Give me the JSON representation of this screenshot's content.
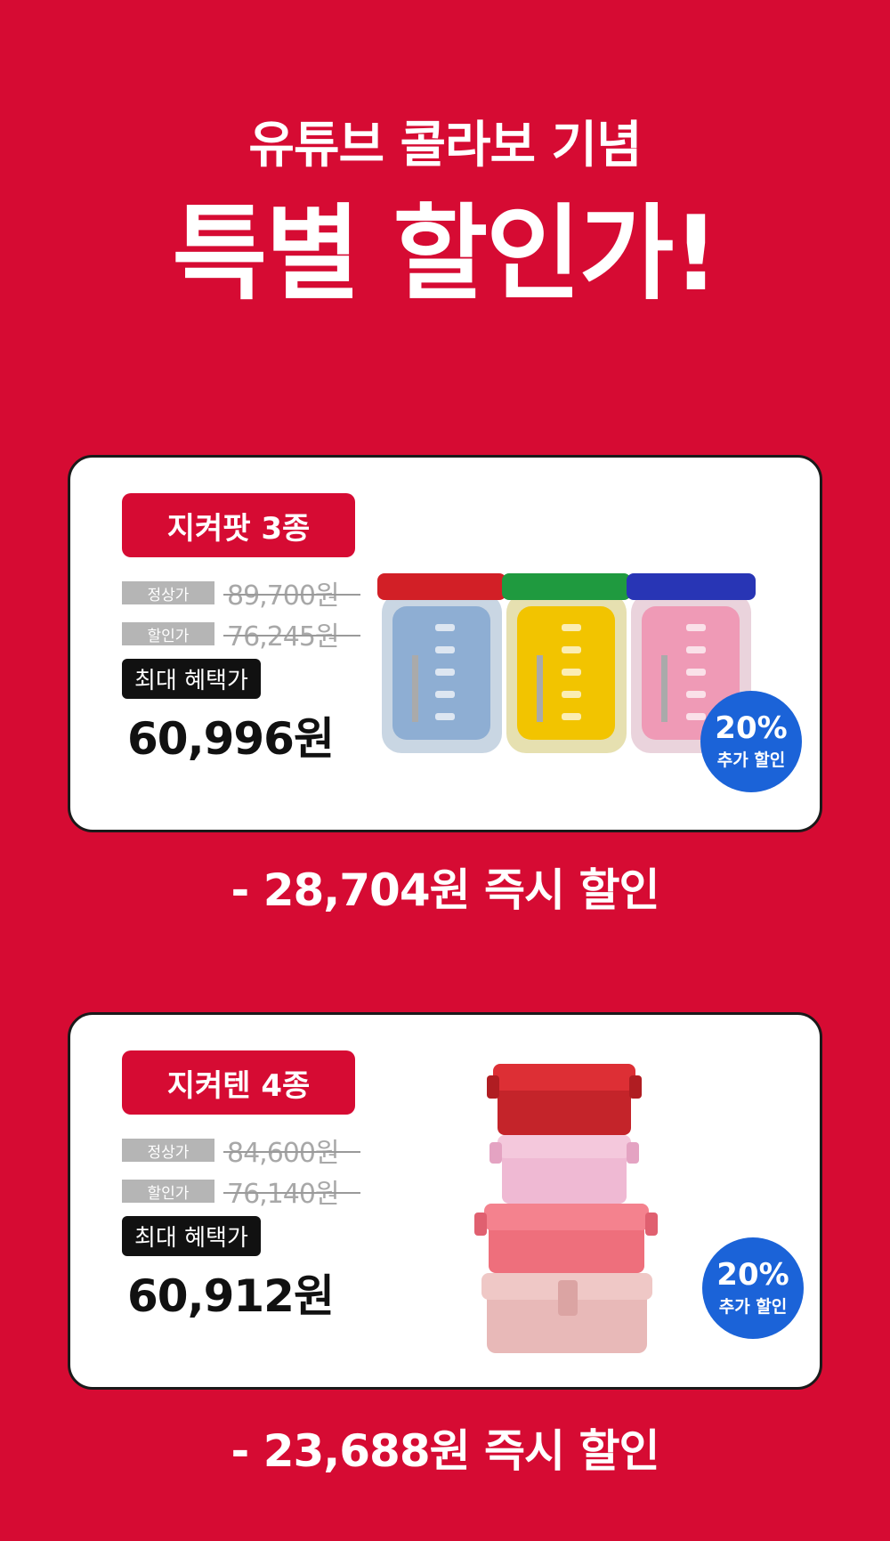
{
  "headline": {
    "line1": "유튜브 콜라보 기념",
    "line2": "특별 할인가!"
  },
  "products": [
    {
      "name": "지켜팟 3종",
      "regular_label": "정상가",
      "regular_price": "89,700원",
      "sale_label": "할인가",
      "sale_price": "76,245원",
      "benefit_label": "최대 혜택가",
      "final_price": "60,996원",
      "badge_pct": "20%",
      "badge_text": "추가 할인",
      "discount_text": "- 28,704원 즉시 할인"
    },
    {
      "name": "지켜텐 4종",
      "regular_label": "정상가",
      "regular_price": "84,600원",
      "sale_label": "할인가",
      "sale_price": "76,140원",
      "benefit_label": "최대 혜택가",
      "final_price": "60,912원",
      "badge_pct": "20%",
      "badge_text": "추가 할인",
      "discount_text": "- 23,688원 즉시 할인"
    }
  ],
  "colors": {
    "background": "#d60b33",
    "badge": "#1b63d8"
  }
}
